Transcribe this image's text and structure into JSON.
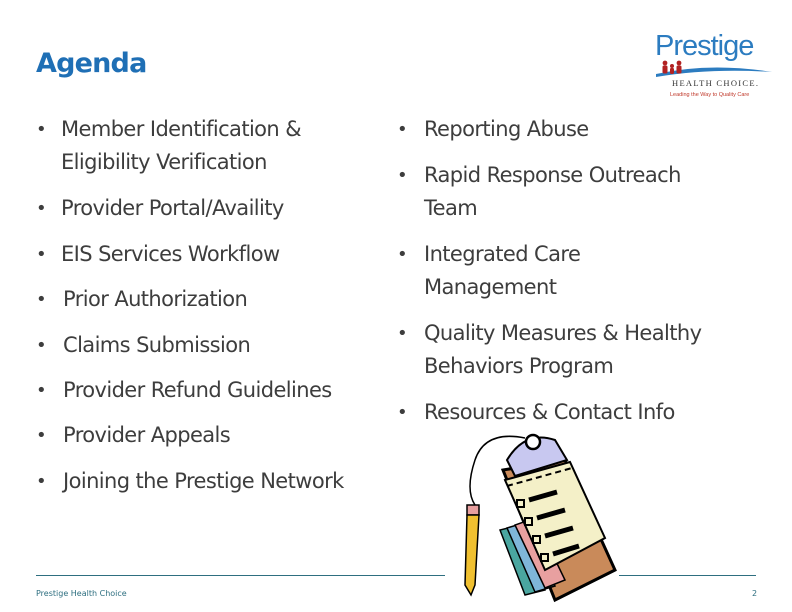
{
  "slide": {
    "title": "Agenda",
    "logo": {
      "name": "Prestige",
      "subtitle": "HEALTH CHOICE.",
      "tagline": "Leading the Way to Quality Care",
      "colors": {
        "primary": "#2c7cc0",
        "accent": "#c0392b"
      }
    },
    "left_items": [
      {
        "lines": [
          "Member Identification &",
          "Eligibility Verification"
        ]
      },
      {
        "lines": [
          "Provider Portal/Availity"
        ]
      },
      {
        "lines": [
          "EIS Services Workflow"
        ]
      },
      {
        "lines": [
          "Prior Authorization"
        ]
      },
      {
        "lines": [
          "Claims Submission"
        ]
      },
      {
        "lines": [
          "Provider Refund Guidelines"
        ]
      },
      {
        "lines": [
          "Provider Appeals"
        ]
      },
      {
        "lines": [
          "Joining the Prestige Network"
        ]
      }
    ],
    "right_items": [
      {
        "lines": [
          "Reporting Abuse"
        ]
      },
      {
        "lines": [
          "Rapid Response Outreach",
          "Team"
        ]
      },
      {
        "lines": [
          "Integrated Care",
          "Management"
        ]
      },
      {
        "lines": [
          "Quality Measures & Healthy",
          "Behaviors Program"
        ]
      },
      {
        "lines": [
          "Resources & Contact Info"
        ]
      }
    ],
    "bullet": "•",
    "footer": {
      "left": "Prestige Health Choice",
      "page_number": "2"
    },
    "colors": {
      "title": "#1f6fb5",
      "body_text": "#3d3d3d",
      "footer": "#2e6f80"
    }
  }
}
